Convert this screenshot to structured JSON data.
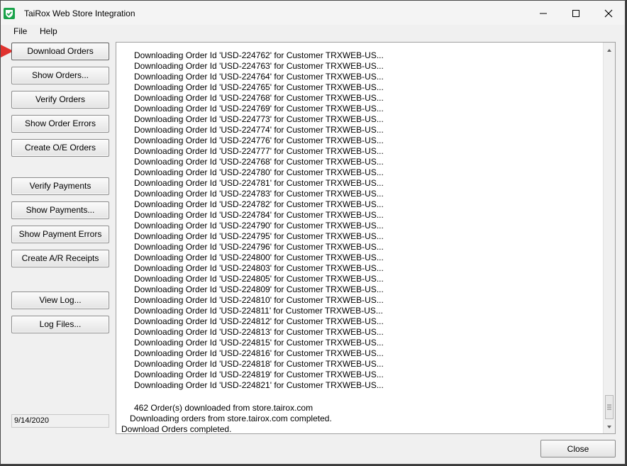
{
  "window": {
    "title": "TaiRox Web Store Integration",
    "icon": "tairox-shield-icon"
  },
  "menu": {
    "file": "File",
    "help": "Help"
  },
  "buttons": {
    "download_orders": "Download Orders",
    "show_orders": "Show Orders...",
    "verify_orders": "Verify Orders",
    "show_order_errors": "Show Order Errors",
    "create_oe_orders": "Create O/E Orders",
    "verify_payments": "Verify Payments",
    "show_payments": "Show Payments...",
    "show_payment_errors": "Show Payment Errors",
    "create_ar_receipts": "Create A/R Receipts",
    "view_log": "View Log...",
    "log_files": "Log Files...",
    "close": "Close"
  },
  "status": {
    "date": "9/14/2020"
  },
  "log": {
    "order_lines": [
      "Downloading Order Id 'USD-224762' for Customer TRXWEB-US...",
      "Downloading Order Id 'USD-224763' for Customer TRXWEB-US...",
      "Downloading Order Id 'USD-224764' for Customer TRXWEB-US...",
      "Downloading Order Id 'USD-224765' for Customer TRXWEB-US...",
      "Downloading Order Id 'USD-224768' for Customer TRXWEB-US...",
      "Downloading Order Id 'USD-224769' for Customer TRXWEB-US...",
      "Downloading Order Id 'USD-224773' for Customer TRXWEB-US...",
      "Downloading Order Id 'USD-224774' for Customer TRXWEB-US...",
      "Downloading Order Id 'USD-224776' for Customer TRXWEB-US...",
      "Downloading Order Id 'USD-224777' for Customer TRXWEB-US...",
      "Downloading Order Id 'USD-224768' for Customer TRXWEB-US...",
      "Downloading Order Id 'USD-224780' for Customer TRXWEB-US...",
      "Downloading Order Id 'USD-224781' for Customer TRXWEB-US...",
      "Downloading Order Id 'USD-224783' for Customer TRXWEB-US...",
      "Downloading Order Id 'USD-224782' for Customer TRXWEB-US...",
      "Downloading Order Id 'USD-224784' for Customer TRXWEB-US...",
      "Downloading Order Id 'USD-224790' for Customer TRXWEB-US...",
      "Downloading Order Id 'USD-224795' for Customer TRXWEB-US...",
      "Downloading Order Id 'USD-224796' for Customer TRXWEB-US...",
      "Downloading Order Id 'USD-224800' for Customer TRXWEB-US...",
      "Downloading Order Id 'USD-224803' for Customer TRXWEB-US...",
      "Downloading Order Id 'USD-224805' for Customer TRXWEB-US...",
      "Downloading Order Id 'USD-224809' for Customer TRXWEB-US...",
      "Downloading Order Id 'USD-224810' for Customer TRXWEB-US...",
      "Downloading Order Id 'USD-224811' for Customer TRXWEB-US...",
      "Downloading Order Id 'USD-224812' for Customer TRXWEB-US...",
      "Downloading Order Id 'USD-224813' for Customer TRXWEB-US...",
      "Downloading Order Id 'USD-224815' for Customer TRXWEB-US...",
      "Downloading Order Id 'USD-224816' for Customer TRXWEB-US...",
      "Downloading Order Id 'USD-224818' for Customer TRXWEB-US...",
      "Downloading Order Id 'USD-224819' for Customer TRXWEB-US...",
      "Downloading Order Id 'USD-224821' for Customer TRXWEB-US..."
    ],
    "summary_count": "462 Order(s) downloaded from store.tairox.com",
    "summary_completed": "Downloading orders from store.tairox.com completed.",
    "summary_done": "Download Orders completed."
  },
  "colors": {
    "pointer_arrow": "#e0332f",
    "icon_green": "#1aa34a"
  }
}
